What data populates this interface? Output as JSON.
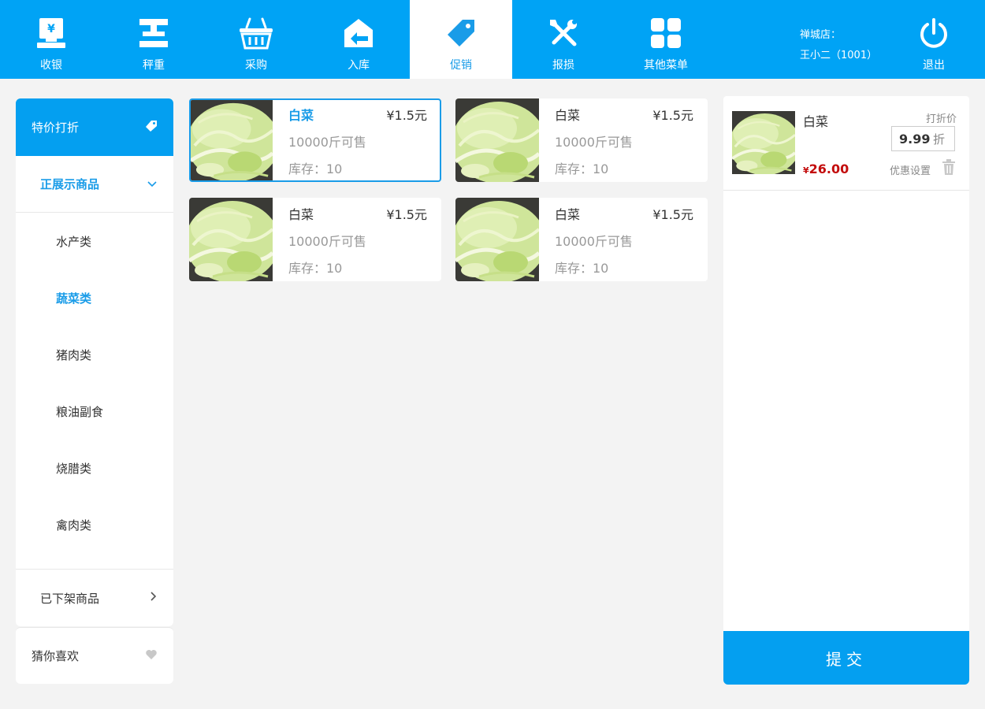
{
  "nav": {
    "items": [
      {
        "label": "收银",
        "icon": "cash-register-icon"
      },
      {
        "label": "秤重",
        "icon": "scale-icon"
      },
      {
        "label": "采购",
        "icon": "basket-icon"
      },
      {
        "label": "入库",
        "icon": "warehouse-in-icon"
      },
      {
        "label": "促销",
        "icon": "tag-icon",
        "active": true
      },
      {
        "label": "报损",
        "icon": "tools-icon"
      },
      {
        "label": "其他菜单",
        "icon": "grid-icon"
      }
    ],
    "store_label": "禅城店：",
    "user": "王小二（1001）",
    "logout_label": "退出",
    "bg_color": "#00a3f5"
  },
  "sidebar": {
    "header": "特价打折",
    "group_open": "正展示商品",
    "subitems": [
      "水产类",
      "蔬菜类",
      "猪肉类",
      "粮油副食",
      "烧腊类",
      "禽肉类"
    ],
    "active_sub": "蔬菜类",
    "group_closed": "已下架商品",
    "favorites": "猜你喜欢"
  },
  "products": [
    {
      "name": "白菜",
      "price": "¥1.5元",
      "available": "10000斤可售",
      "stock": "库存：10",
      "selected": true
    },
    {
      "name": "白菜",
      "price": "¥1.5元",
      "available": "10000斤可售",
      "stock": "库存：10"
    },
    {
      "name": "白菜",
      "price": "¥1.5元",
      "available": "10000斤可售",
      "stock": "库存：10"
    },
    {
      "name": "白菜",
      "price": "¥1.5元",
      "available": "10000斤可售",
      "stock": "库存：10"
    }
  ],
  "cart": {
    "item": {
      "name": "白菜",
      "discount_label": "打折价",
      "discount_value": "9.99",
      "discount_unit": "折",
      "currency": "¥",
      "total": "26.00",
      "setting_label": "优惠设置"
    },
    "submit_label": "提交"
  },
  "colors": {
    "accent": "#1a9ce8",
    "price_red": "#c30d0d"
  }
}
